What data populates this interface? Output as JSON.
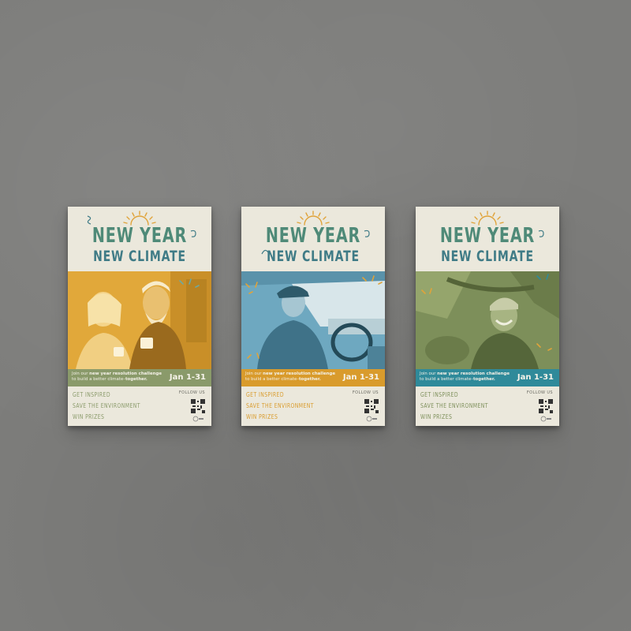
{
  "posters": [
    {
      "title_line1": "NEW YEAR",
      "title_line2": "NEW CLIMATE",
      "band_text_pre": "Join our ",
      "band_text_bold": "new year resolution challenge",
      "band_text_post": "to build a better climate–",
      "band_text_bold2": "together.",
      "dates": "Jan 1-31",
      "bullets": [
        "GET INSPIRED",
        "SAVE THE ENVIRONMENT",
        "WIN PRIZES"
      ],
      "follow": "FOLLOW US",
      "accent": "#8a9a6a",
      "photo_tint": "#e1a83a",
      "bullet_color": "#8a9a6a"
    },
    {
      "title_line1": "NEW YEAR",
      "title_line2": "NEW CLIMATE",
      "band_text_pre": "Join our ",
      "band_text_bold": "new year resolution challenge",
      "band_text_post": "to build a better climate–",
      "band_text_bold2": "together.",
      "dates": "Jan 1-31",
      "bullets": [
        "GET INSPIRED",
        "SAVE THE ENVIRONMENT",
        "WIN PRIZES"
      ],
      "follow": "FOLLOW US",
      "accent": "#d99b2c",
      "photo_tint": "#6ea8c0",
      "bullet_color": "#d99b2c"
    },
    {
      "title_line1": "NEW YEAR",
      "title_line2": "NEW CLIMATE",
      "band_text_pre": "Join our ",
      "band_text_bold": "new year resolution challenge",
      "band_text_post": "to build a better climate–",
      "band_text_bold2": "together.",
      "dates": "Jan 1-31",
      "bullets": [
        "GET INSPIRED",
        "SAVE THE ENVIRONMENT",
        "WIN PRIZES"
      ],
      "follow": "FOLLOW US",
      "accent": "#2f8a9a",
      "photo_tint": "#7d8f5a",
      "bullet_color": "#7d8f5a"
    }
  ],
  "colors": {
    "wall": "#7d7d7b",
    "paper": "#ebe8dc",
    "title_green": "#4f8a78",
    "title_teal": "#3f7b86",
    "sun": "#e0a33a"
  },
  "icons": [
    "sun-icon",
    "squiggle-icon",
    "qr-code-icon",
    "arrow-icon",
    "logo-icon"
  ]
}
